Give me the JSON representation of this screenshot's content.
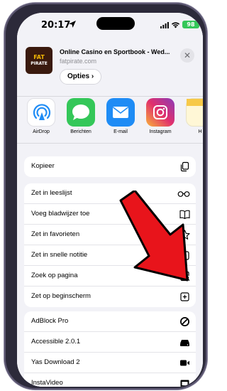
{
  "status_bar": {
    "time": "20:17",
    "battery": "98"
  },
  "sheet": {
    "site_title": "Online Casino en Sportbook - Wed...",
    "site_domain": "fatpirate.com",
    "options_label": "Opties",
    "options_chevron": "›",
    "close_glyph": "✕",
    "logo_line1": "FAT",
    "logo_line2": "PIRATE"
  },
  "apps": [
    {
      "label": "AirDrop",
      "icon": "airdrop-icon"
    },
    {
      "label": "Berichten",
      "icon": "messages-icon"
    },
    {
      "label": "E-mail",
      "icon": "mail-icon"
    },
    {
      "label": "Instagram",
      "icon": "instagram-icon"
    },
    {
      "label": "H",
      "icon": "notes-icon"
    }
  ],
  "actions_group1": [
    {
      "label": "Kopieer",
      "icon": "copy-icon"
    }
  ],
  "actions_group2": [
    {
      "label": "Zet in leeslijst",
      "icon": "glasses-icon"
    },
    {
      "label": "Voeg bladwijzer toe",
      "icon": "book-icon"
    },
    {
      "label": "Zet in favorieten",
      "icon": "star-icon"
    },
    {
      "label": "Zet in snelle notitie",
      "icon": "quick-note-icon"
    },
    {
      "label": "Zoek op pagina",
      "icon": "find-on-page-icon"
    },
    {
      "label": "Zet op beginscherm",
      "icon": "add-to-home-icon"
    }
  ],
  "actions_group3": [
    {
      "label": "AdBlock Pro",
      "icon": "block-icon"
    },
    {
      "label": "Accessible 2.0.1",
      "icon": "drive-icon"
    },
    {
      "label": "Yas Download 2",
      "icon": "video-camera-icon"
    },
    {
      "label": "InstaVideo",
      "icon": "film-icon"
    }
  ],
  "colors": {
    "annotation_arrow": "#e8141b",
    "battery": "#34c759",
    "messages": "#34c759",
    "mail": "#1f8cf5"
  }
}
